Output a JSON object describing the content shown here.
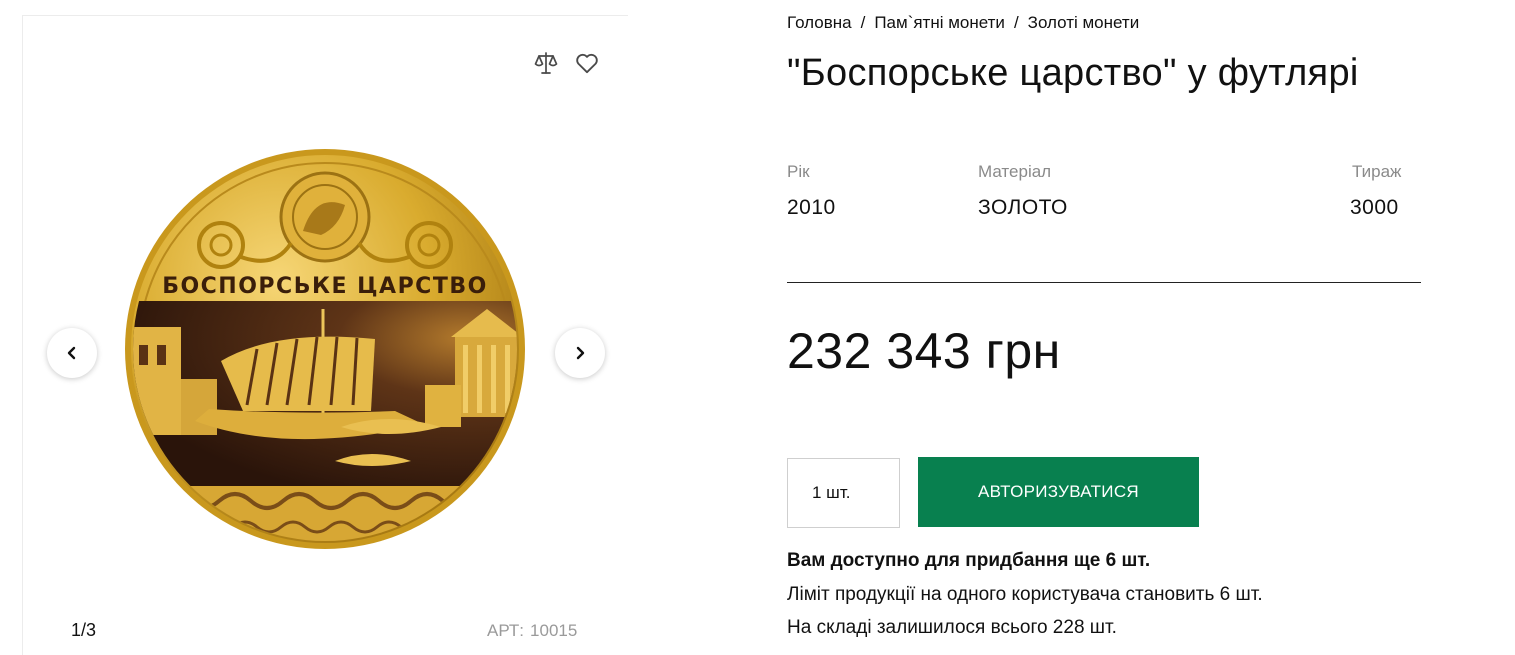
{
  "breadcrumb": {
    "home": "Головна",
    "sep1": "/",
    "commemorative": "Пам`ятні монети",
    "sep2": "/",
    "gold": "Золоті монети"
  },
  "product": {
    "title": "\"Боспорське царство\" у футлярі",
    "coin_inscription": "БОСПОРСЬКЕ ЦАРСТВО",
    "specs": {
      "year_label": "Рік",
      "year": "2010",
      "material_label": "Матеріал",
      "material": "ЗОЛОТО",
      "mintage_label": "Тираж",
      "mintage": "3000"
    },
    "price": "232 343 грн",
    "quantity_value": "1 шт.",
    "auth_button": "АВТОРИЗУВАТИСЯ",
    "availability": "Вам доступно для придбання ще 6 шт.",
    "limit": "Ліміт продукції на одного користувача становить 6 шт.",
    "stock": "На складі залишилося всього 228 шт."
  },
  "gallery": {
    "counter": "1/3",
    "art_label": "АРТ:",
    "art_value": "10015"
  },
  "icons": {
    "compare": "scales-icon",
    "favorite": "heart-icon",
    "prev": "chevron-left-icon",
    "next": "chevron-right-icon"
  },
  "colors": {
    "accent": "#08804f",
    "gold": "#d4a82a",
    "coin_dark": "#3a1e10"
  }
}
